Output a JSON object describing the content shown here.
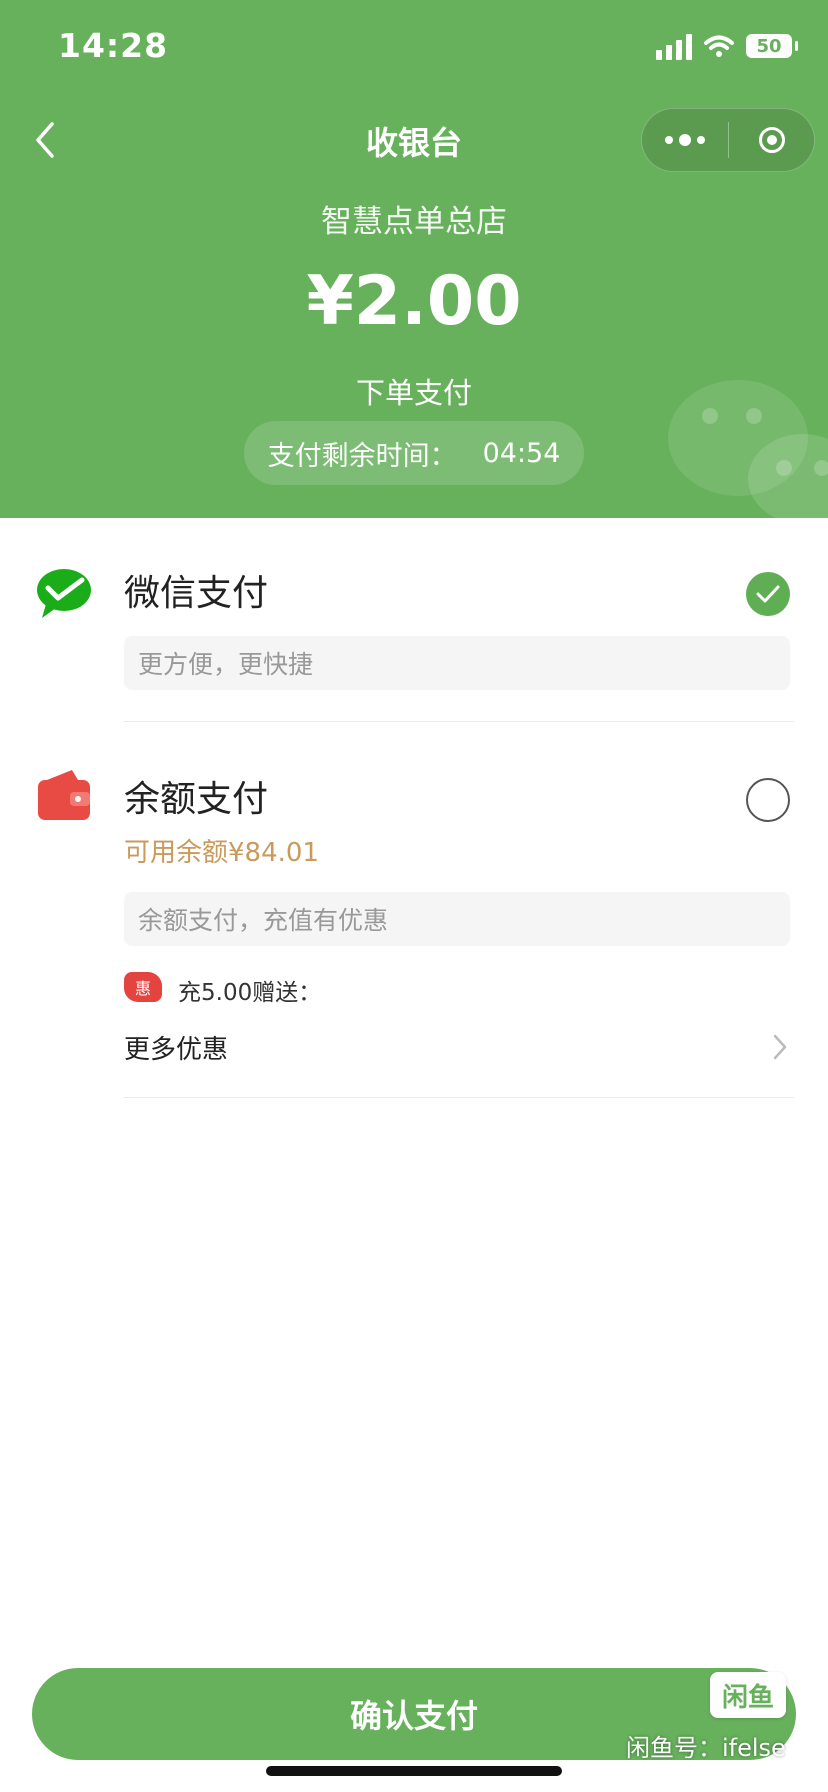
{
  "status_bar": {
    "time": "14:28",
    "battery": "50"
  },
  "nav": {
    "title": "收银台"
  },
  "header": {
    "store_name": "智慧点单总店",
    "amount": "¥2.00",
    "pay_label": "下单支付",
    "timer_label": "支付剩余时间：",
    "timer_value": "04:54"
  },
  "payment_options": [
    {
      "title": "微信支付",
      "desc": "更方便，更快捷",
      "selected": true
    },
    {
      "title": "余额支付",
      "balance": "可用余额¥84.01",
      "desc": "余额支付，充值有优惠",
      "selected": false,
      "promo_tag": "惠",
      "promo_text": "充5.00赠送：",
      "more_label": "更多优惠"
    }
  ],
  "confirm_button": "确认支付",
  "watermark": {
    "logo": "闲鱼",
    "text": "闲鱼号：ifelse"
  },
  "colors": {
    "brand_green": "#67b15c",
    "balance_gold": "#c99a5b",
    "promo_red": "#e34440"
  }
}
